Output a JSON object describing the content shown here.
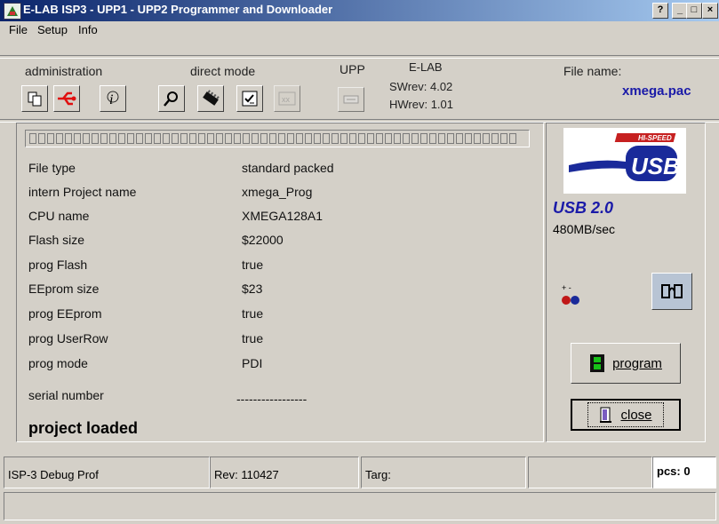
{
  "window": {
    "title": "E-LAB ISP3 - UPP1 - UPP2 Programmer and Downloader",
    "help_btn": "?",
    "min_btn": "_",
    "max_btn": "□",
    "close_btn": "×"
  },
  "menu": [
    "File",
    "Setup",
    "Info"
  ],
  "toolbar": {
    "administration_label": "administration",
    "direct_mode_label": "direct mode",
    "upp_label": "UPP",
    "elab_label": "E-LAB",
    "swrev": "SWrev:  4.02",
    "hwrev": "HWrev:  1.01",
    "file_name_label": "File name:",
    "file_name": "xmega.pac"
  },
  "info_rows": [
    {
      "label": "File type",
      "value": "standard packed"
    },
    {
      "label": "intern Project name",
      "value": "xmega_Prog"
    },
    {
      "label": "CPU name",
      "value": "XMEGA128A1"
    },
    {
      "label": "Flash size",
      "value": "$22000"
    },
    {
      "label": "prog Flash",
      "value": "true"
    },
    {
      "label": "EEprom size",
      "value": "$23"
    },
    {
      "label": "prog EEprom",
      "value": "true"
    },
    {
      "label": "prog UserRow",
      "value": "true"
    },
    {
      "label": "prog mode",
      "value": "PDI"
    }
  ],
  "serial": {
    "label": "serial number",
    "value": "-----------------"
  },
  "project_status": "project loaded",
  "usb": {
    "logo_top": "HI-SPEED",
    "logo_text": "USB",
    "version": "USB 2.0",
    "speed": "480MB/sec"
  },
  "buttons": {
    "program": "program",
    "close": "close"
  },
  "statusbar": {
    "device": "ISP-3 Debug Prof",
    "rev": "Rev: 110427",
    "targ": "Targ:",
    "empty": "",
    "pcs": "pcs: 0"
  },
  "colors": {
    "titlebar": "#0a246a",
    "accent_blue": "#1a1aa8",
    "face": "#d4d0c8"
  }
}
